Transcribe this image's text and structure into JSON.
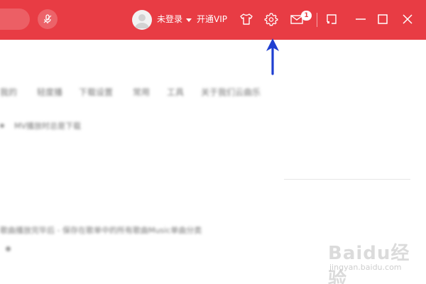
{
  "header": {
    "login_label": "未登录",
    "vip_label": "开通VIP",
    "mail_count": "1",
    "icons": [
      "microphone-icon",
      "user-avatar-icon",
      "skin-tshirt-icon",
      "settings-gear-icon",
      "mail-icon",
      "mini-mode-icon",
      "minimize-icon",
      "maximize-icon",
      "close-icon"
    ]
  },
  "blurred_nav": [
    "我的",
    "轻度播",
    "下载设置",
    "常用",
    "工具",
    "关于我们云曲乐"
  ],
  "blurred_lines": [
    "MV播放时总是下载",
    "歌曲播放完毕后 - 保存在歌单中的所有歌曲Music单曲分类"
  ],
  "annotation": {
    "color": "#1f3fd1",
    "points_to": "settings-gear-icon"
  },
  "watermark": {
    "brand": "Baidu经验",
    "url": "jingyan.baidu.com"
  },
  "colors": {
    "titlebar": "#e83c44",
    "text_on_bar": "#ffffff"
  }
}
